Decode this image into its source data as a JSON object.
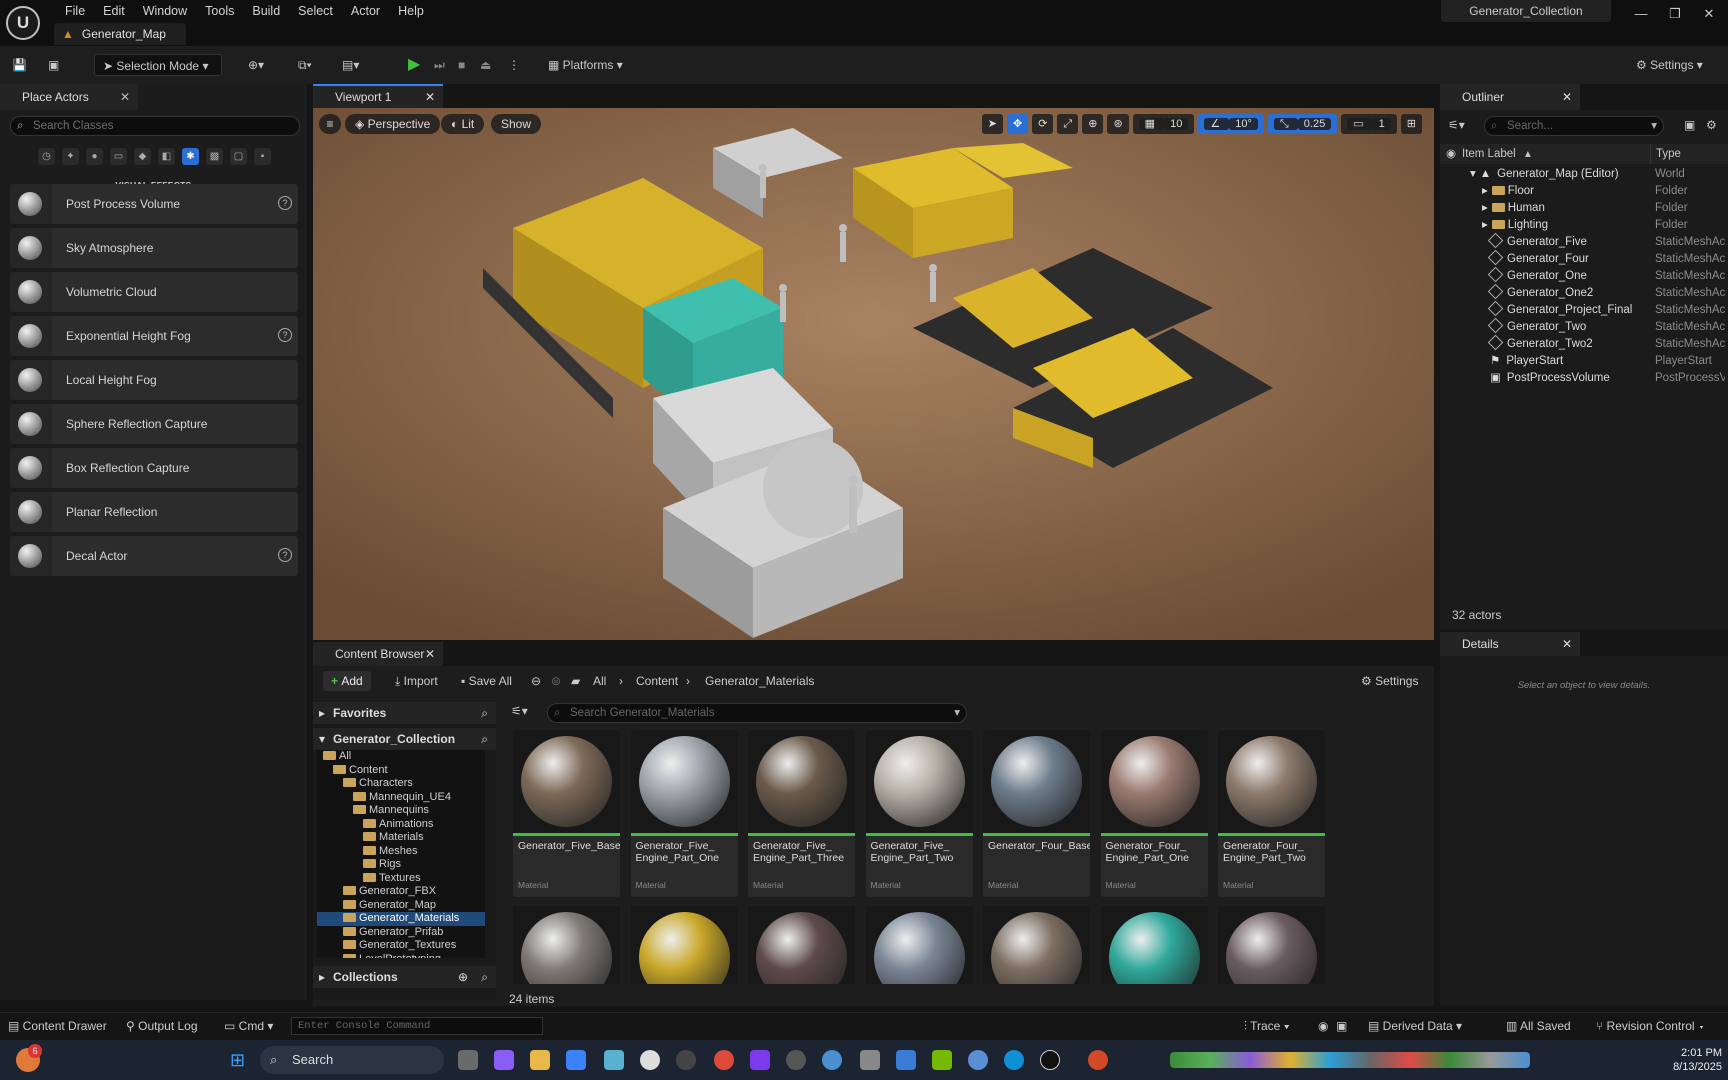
{
  "app": {
    "logo": "unreal-logo",
    "menu": [
      "File",
      "Edit",
      "Window",
      "Tools",
      "Build",
      "Select",
      "Actor",
      "Help"
    ],
    "map_tab": "Generator_Map",
    "project_name": "Generator_Collection"
  },
  "toolbar": {
    "selection_mode": "Selection Mode",
    "platforms": "Platforms",
    "settings": "Settings"
  },
  "place_actors": {
    "title": "Place Actors",
    "search_placeholder": "Search Classes",
    "category_label": "VISUAL EFFECTS",
    "items": [
      {
        "label": "Post Process Volume",
        "help": true
      },
      {
        "label": "Sky Atmosphere",
        "help": false
      },
      {
        "label": "Volumetric Cloud",
        "help": false
      },
      {
        "label": "Exponential Height Fog",
        "help": true
      },
      {
        "label": "Local Height Fog",
        "help": false
      },
      {
        "label": "Sphere Reflection Capture",
        "help": false
      },
      {
        "label": "Box Reflection Capture",
        "help": false
      },
      {
        "label": "Planar Reflection",
        "help": false
      },
      {
        "label": "Decal Actor",
        "help": true
      }
    ]
  },
  "viewport": {
    "tab": "Viewport 1",
    "perspective": "Perspective",
    "lit": "Lit",
    "show": "Show",
    "grid_snap": "10",
    "rotation_snap": "10°",
    "scale_snap": "0.25",
    "camera_speed": "1"
  },
  "content_browser": {
    "tab": "Content Browser",
    "add": "Add",
    "import": "Import",
    "save_all": "Save All",
    "breadcrumb": [
      "All",
      "Content",
      "Generator_Materials"
    ],
    "settings": "Settings",
    "favorites": "Favorites",
    "collection": "Generator_Collection",
    "collections": "Collections",
    "search_placeholder": "Search Generator_Materials",
    "tree": [
      {
        "label": "All",
        "indent": 0
      },
      {
        "label": "Content",
        "indent": 1
      },
      {
        "label": "Characters",
        "indent": 2
      },
      {
        "label": "Mannequin_UE4",
        "indent": 3
      },
      {
        "label": "Mannequins",
        "indent": 3
      },
      {
        "label": "Animations",
        "indent": 4
      },
      {
        "label": "Materials",
        "indent": 4
      },
      {
        "label": "Meshes",
        "indent": 4
      },
      {
        "label": "Rigs",
        "indent": 4
      },
      {
        "label": "Textures",
        "indent": 4
      },
      {
        "label": "Generator_FBX",
        "indent": 2
      },
      {
        "label": "Generator_Map",
        "indent": 2
      },
      {
        "label": "Generator_Materials",
        "indent": 2,
        "selected": true
      },
      {
        "label": "Generator_Prifab",
        "indent": 2
      },
      {
        "label": "Generator_Textures",
        "indent": 2
      },
      {
        "label": "LevelPrototyping",
        "indent": 2
      },
      {
        "label": "StarterContent",
        "indent": 2
      }
    ],
    "assets": [
      {
        "name": "Generator_Five_Base",
        "type": "Material",
        "color": "#7d6a58"
      },
      {
        "name": "Generator_Five_ Engine_Part_One",
        "type": "Material",
        "color": "#a0a6ad"
      },
      {
        "name": "Generator_Five_ Engine_Part_Three",
        "type": "Material",
        "color": "#6a5a4a"
      },
      {
        "name": "Generator_Five_ Engine_Part_Two",
        "type": "Material",
        "color": "#b7b0a8"
      },
      {
        "name": "Generator_Four_Base",
        "type": "Material",
        "color": "#6e7d8c"
      },
      {
        "name": "Generator_Four_ Engine_Part_One",
        "type": "Material",
        "color": "#9a7a70"
      },
      {
        "name": "Generator_Four_ Engine_Part_Two",
        "type": "Material",
        "color": "#8c7a6c"
      }
    ],
    "row2_colors": [
      "#7e7a76",
      "#c9a82a",
      "#5e4b4b",
      "#7a8696",
      "#7c6e62",
      "#2fa89a",
      "#6a5c60"
    ],
    "item_count": "24 items"
  },
  "outliner": {
    "title": "Outliner",
    "search_placeholder": "Search...",
    "col_label": "Item Label",
    "col_type": "Type",
    "rows": [
      {
        "label": "Generator_Map (Editor)",
        "type": "World",
        "kind": "world",
        "indent": 1
      },
      {
        "label": "Floor",
        "type": "Folder",
        "kind": "folder",
        "indent": 2
      },
      {
        "label": "Human",
        "type": "Folder",
        "kind": "folder",
        "indent": 2
      },
      {
        "label": "Lighting",
        "type": "Folder",
        "kind": "folder",
        "indent": 2
      },
      {
        "label": "Generator_Five",
        "type": "StaticMeshAc",
        "kind": "mesh",
        "indent": 2
      },
      {
        "label": "Generator_Four",
        "type": "StaticMeshAc",
        "kind": "mesh",
        "indent": 2
      },
      {
        "label": "Generator_One",
        "type": "StaticMeshAc",
        "kind": "mesh",
        "indent": 2
      },
      {
        "label": "Generator_One2",
        "type": "StaticMeshAc",
        "kind": "mesh",
        "indent": 2
      },
      {
        "label": "Generator_Project_Final",
        "type": "StaticMeshAc",
        "kind": "mesh",
        "indent": 2
      },
      {
        "label": "Generator_Two",
        "type": "StaticMeshAc",
        "kind": "mesh",
        "indent": 2
      },
      {
        "label": "Generator_Two2",
        "type": "StaticMeshAc",
        "kind": "mesh",
        "indent": 2
      },
      {
        "label": "PlayerStart",
        "type": "PlayerStart",
        "kind": "player",
        "indent": 2
      },
      {
        "label": "PostProcessVolume",
        "type": "PostProcessV",
        "kind": "volume",
        "indent": 2
      }
    ],
    "actor_count": "32 actors"
  },
  "details": {
    "title": "Details",
    "empty": "Select an object to view details."
  },
  "statusbar": {
    "content_drawer": "Content Drawer",
    "output_log": "Output Log",
    "cmd": "Cmd",
    "console_placeholder": "Enter Console Command",
    "trace": "Trace",
    "derived_data": "Derived Data",
    "all_saved": "All Saved",
    "revision_control": "Revision Control"
  },
  "taskbar": {
    "search": "Search",
    "time": "2:01 PM",
    "date": "8/13/2025",
    "badge": "6"
  }
}
